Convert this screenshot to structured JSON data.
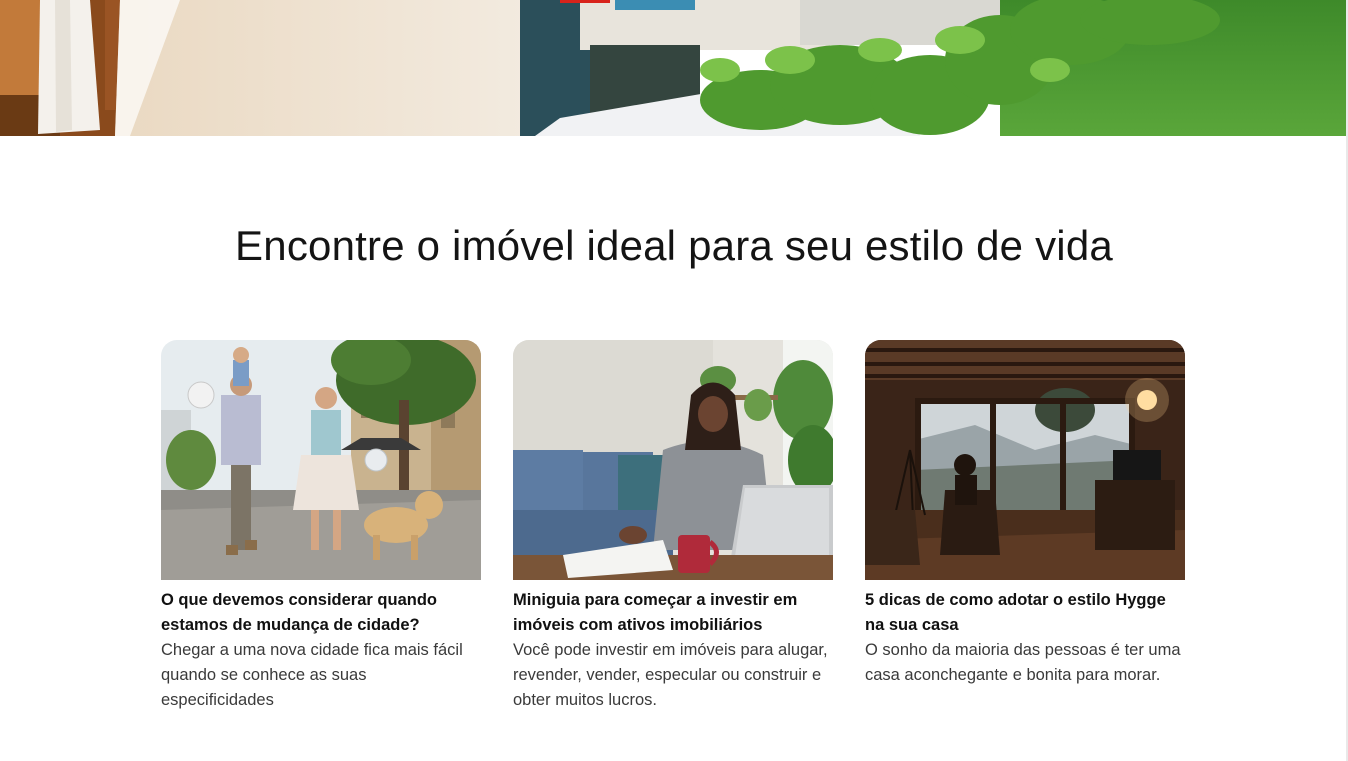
{
  "hero": {
    "image": "hotel-pool-terrace-photo"
  },
  "section": {
    "title": "Encontre o imóvel ideal para seu estilo de vida"
  },
  "cards": [
    {
      "image": "family-walking-dog-photo",
      "title": "O que devemos considerar quando estamos de mudança de cidade?",
      "description": "Chegar a uma nova cidade fica mais fácil quando se conhece as suas especificidades"
    },
    {
      "image": "woman-laptop-living-room-photo",
      "title": "Miniguia para começar a investir em imóveis com ativos imobiliários",
      "description": "Você pode investir em imóveis para alugar, revender, vender, especular ou construir e obter muitos lucros."
    },
    {
      "image": "cozy-cabin-window-photo",
      "title": "5 dicas de como adotar o estilo Hygge na sua casa",
      "description": "O sonho da maioria das pessoas é ter uma casa aconchegante e bonita para morar."
    }
  ]
}
